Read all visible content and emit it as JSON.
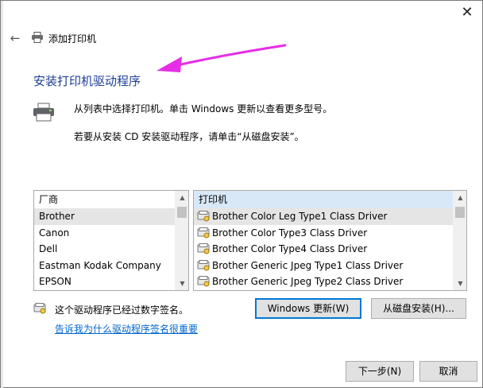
{
  "window": {
    "close_glyph": "✕"
  },
  "nav": {
    "back_glyph": "←",
    "title": "添加打印机"
  },
  "heading": "安装打印机驱动程序",
  "annotation": {
    "arrow_color": "#e62ee6"
  },
  "description": {
    "line1": "从列表中选择打印机。单击 Windows 更新以查看更多型号。",
    "line2": "若要从安装 CD 安装驱动程序，请单击“从磁盘安装”。"
  },
  "manufacturers": {
    "header": "厂商",
    "items": [
      "Brother",
      "Canon",
      "Dell",
      "Eastman Kodak Company",
      "EPSON"
    ],
    "selected_index": 0
  },
  "printers": {
    "header": "打印机",
    "items": [
      "Brother Color Leg Type1 Class Driver",
      "Brother Color Type3 Class Driver",
      "Brother Color Type4 Class Driver",
      "Brother Generic Jpeg Type1 Class Driver",
      "Brother Generic Jpeg Type2 Class Driver"
    ],
    "selected_index": 0
  },
  "scrollbar": {
    "up_glyph": "▲",
    "down_glyph": "▼"
  },
  "signature": {
    "text": "这个驱动程序已经过数字签名。",
    "link": "告诉我为什么驱动程序签名很重要"
  },
  "buttons": {
    "windows_update": "Windows 更新(W)",
    "have_disk": "从磁盘安装(H)...",
    "next": "下一步(N)",
    "cancel": "取消"
  },
  "colors": {
    "heading": "#1c3f95",
    "link": "#0066cc",
    "list_header_highlight": "#d9e8f6",
    "default_button_border": "#0078d7"
  }
}
